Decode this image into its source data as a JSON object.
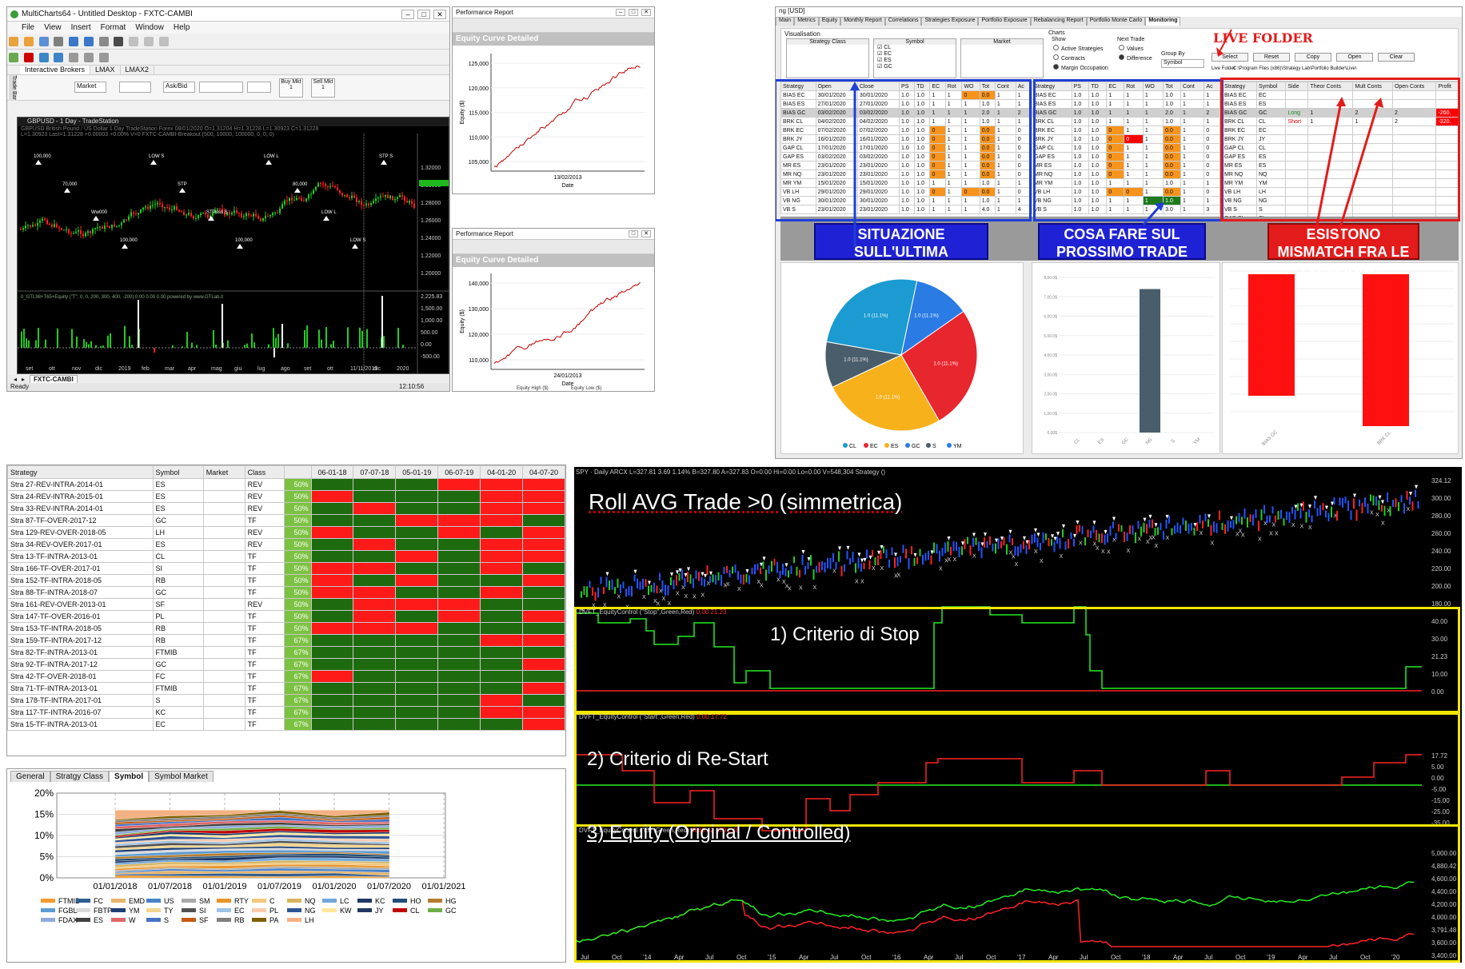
{
  "multicharts": {
    "title": "MultiCharts64 - Untitled Desktop - FXTC-CAMBI",
    "menu": [
      "File",
      "View",
      "Insert",
      "Format",
      "Window",
      "Help"
    ],
    "side_label": "Trade Bar",
    "broker_tabs": [
      "Interactive Brokers",
      "LMAX",
      "LMAX2"
    ],
    "order_fields": {
      "order_type": "Market",
      "ask_bid": "Ask/Bid",
      "buy_mkt": "Buy Mkt",
      "buy_qty": "1",
      "sell_mkt": "Sell Mkt",
      "sell_qty": "1"
    },
    "chart_title": "GBPUSD - 1 Day - TradeStation",
    "chart_info": "GBPUSD  British Pound / US Dollar  1 Day  TradeStation  Forex  08/01/2020  O=1.31204  H=1.31228  L=1.30923  C=1.31228",
    "chart_info2": "L=1.30923  Last=1.31228  +0.00003  +0.00%  V=0  FXTC-CAMBI-Breakout (500, 10000, 100000, 0, 0, 0)",
    "indicator_label": "0_GTL98+T65+Equity  (\"T\", 0, 0, 200, 300, 400, -200)  0.00  0.00  0.00  powered by www.GTLab.it",
    "price_ticks": [
      "1.32000",
      "1.30000",
      "1.28000",
      "1.26000",
      "1.24000",
      "1.22000",
      "1.20000"
    ],
    "ind_ticks": [
      "2,225.83",
      "1,500.00",
      "1,000.00",
      "500.00",
      "0.00",
      "-500.00"
    ],
    "time_ticks": [
      "set",
      "ott",
      "nov",
      "dic",
      "2019",
      "feb",
      "mar",
      "apr",
      "mag",
      "giu",
      "lug",
      "ago",
      "set",
      "ott",
      "11/11/2019",
      "dic",
      "2020"
    ],
    "sheet_tab": "FXTC-CAMBI",
    "status": "Ready",
    "clock": "12:10:56",
    "signals": [
      "100,000",
      "70,000",
      "Ww000",
      "100,000",
      "LOW S",
      "STP",
      "STPoss S",
      "100,000",
      "LOW L",
      "80,000",
      "LOW L",
      "LOW S",
      "STP S"
    ]
  },
  "perf1": {
    "title": "Performance Report",
    "header": "Equity Curve Detailed",
    "ylabel": "Equity ($)",
    "yticks": [
      "125,000",
      "120,000",
      "115,000",
      "110,000",
      "105,000"
    ],
    "date_tick": "13/02/2013",
    "xlabel": "Date"
  },
  "perf2": {
    "title": "Performance Report",
    "header": "Equity Curve Detailed",
    "ylabel": "Equity ($)",
    "yticks": [
      "140,000",
      "130,000",
      "120,000",
      "110,000"
    ],
    "date_tick": "24/01/2013",
    "xlabel": "Date",
    "legend": [
      "Equity High ($)",
      "Equity Low ($)"
    ]
  },
  "portfolio": {
    "title": "ng [USD]",
    "tabs": [
      "Main",
      "Metrics",
      "Equity",
      "Monthly Report",
      "Correlations",
      "Strategies Exposure",
      "Portfolio Exposure",
      "Rebalancing Report",
      "Portfolio Monte Carlo",
      "Monitoring"
    ],
    "visualisation": "Visualisation",
    "col_heads": [
      "Strategy Class",
      "Symbol",
      "Market"
    ],
    "symbols": [
      "CL",
      "EC",
      "ES",
      "GC"
    ],
    "charts_label": "Charts",
    "show_label": "Show",
    "show_opts": [
      "Active Strategies",
      "Contracts",
      "Margin Occupation"
    ],
    "next_trade": "Next Trade",
    "next_opts": [
      "Values",
      "Difference"
    ],
    "group_by": "Group By",
    "group_val": "Symbol",
    "buttons": [
      "Select",
      "Reset",
      "Copy",
      "Open",
      "Clear"
    ],
    "live_folder_label": "Live Folder",
    "live_folder_path": "C:\\Program Files (x86)\\Strategy Lab\\Portfolio Builder\\Live\\",
    "t1_head": [
      "Strategy",
      "Open",
      "Close",
      "PS",
      "TD",
      "EC",
      "Rot",
      "WO",
      "Tot",
      "Cont",
      "Ac"
    ],
    "t1_rows": [
      [
        "BIAS EC",
        "30/01/2020",
        "30/01/2020",
        "1.0",
        "1.0",
        "1",
        "1",
        "0",
        "0.0",
        "1",
        "1"
      ],
      [
        "BIAS ES",
        "27/01/2020",
        "27/01/2020",
        "1.0",
        "1.0",
        "1",
        "1",
        "1",
        "1.0",
        "1",
        "1"
      ],
      [
        "BIAS GC",
        "03/02/2020",
        "03/02/2020",
        "1.0",
        "1.0",
        "1",
        "1",
        "1",
        "2.0",
        "1",
        "2"
      ],
      [
        "BRK CL",
        "04/02/2020",
        "04/02/2020",
        "1.0",
        "1.0",
        "1",
        "1",
        "1",
        "1.0",
        "1",
        "1"
      ],
      [
        "BRK EC",
        "07/02/2020",
        "07/02/2020",
        "1.0",
        "1.0",
        "0",
        "1",
        "1",
        "0.0",
        "1",
        "0"
      ],
      [
        "BRK JY",
        "16/01/2020",
        "16/01/2020",
        "1.0",
        "1.0",
        "0",
        "1",
        "1",
        "0.0",
        "1",
        "0"
      ],
      [
        "GAP CL",
        "17/01/2020",
        "17/01/2020",
        "1.0",
        "1.0",
        "0",
        "1",
        "1",
        "0.0",
        "1",
        "0"
      ],
      [
        "GAP ES",
        "03/02/2020",
        "03/02/2020",
        "1.0",
        "1.0",
        "0",
        "1",
        "1",
        "0.0",
        "1",
        "0"
      ],
      [
        "MR ES",
        "23/01/2020",
        "23/01/2020",
        "1.0",
        "1.0",
        "0",
        "1",
        "1",
        "0.0",
        "1",
        "0"
      ],
      [
        "MR NQ",
        "23/01/2020",
        "23/01/2020",
        "1.0",
        "1.0",
        "0",
        "1",
        "1",
        "0.0",
        "1",
        "0"
      ],
      [
        "MR YM",
        "15/01/2020",
        "15/01/2020",
        "1.0",
        "1.0",
        "1",
        "1",
        "1",
        "1.0",
        "1",
        "1"
      ],
      [
        "VB LH",
        "29/01/2020",
        "29/01/2020",
        "1.0",
        "1.0",
        "0",
        "1",
        "0",
        "0.0",
        "1",
        "0"
      ],
      [
        "VB NG",
        "30/01/2020",
        "30/01/2020",
        "1.0",
        "1.0",
        "1",
        "1",
        "1",
        "1.0",
        "1",
        "1"
      ],
      [
        "VB S",
        "23/01/2020",
        "23/01/2020",
        "1.0",
        "1.0",
        "1",
        "1",
        "1",
        "4.0",
        "1",
        "4"
      ]
    ],
    "t2_head": [
      "Strategy",
      "PS",
      "TD",
      "EC",
      "Rot",
      "WO",
      "Tot",
      "Cont",
      "Ac"
    ],
    "t2_rows": [
      [
        "BIAS EC",
        "1.0",
        "1.0",
        "1",
        "1",
        "1",
        "1.0",
        "1",
        "1"
      ],
      [
        "BIAS ES",
        "1.0",
        "1.0",
        "1",
        "1",
        "1",
        "1.0",
        "1",
        "1"
      ],
      [
        "BIAS GC",
        "1.0",
        "1.0",
        "1",
        "1",
        "1",
        "2.0",
        "1",
        "2"
      ],
      [
        "BRK CL",
        "1.0",
        "1.0",
        "1",
        "1",
        "1",
        "1.0",
        "1",
        "1"
      ],
      [
        "BRK EC",
        "1.0",
        "1.0",
        "0",
        "1",
        "1",
        "0.0",
        "1",
        "0"
      ],
      [
        "BRK JY",
        "1.0",
        "1.0",
        "0",
        "0",
        "1",
        "0.0",
        "1",
        "0"
      ],
      [
        "GAP CL",
        "1.0",
        "1.0",
        "0",
        "1",
        "1",
        "0.0",
        "1",
        "0"
      ],
      [
        "GAP ES",
        "1.0",
        "1.0",
        "0",
        "1",
        "1",
        "0.0",
        "1",
        "0"
      ],
      [
        "MR ES",
        "1.0",
        "1.0",
        "0",
        "1",
        "1",
        "0.0",
        "1",
        "0"
      ],
      [
        "MR NQ",
        "1.0",
        "1.0",
        "0",
        "1",
        "1",
        "0.0",
        "1",
        "0"
      ],
      [
        "MR YM",
        "1.0",
        "1.0",
        "1",
        "1",
        "1",
        "1.0",
        "1",
        "1"
      ],
      [
        "VB LH",
        "1.0",
        "1.0",
        "0",
        "0",
        "1",
        "0.0",
        "1",
        "0"
      ],
      [
        "VB NG",
        "1.0",
        "1.0",
        "1",
        "1",
        "1",
        "1.0",
        "1",
        "1"
      ],
      [
        "VB S",
        "1.0",
        "1.0",
        "1",
        "1",
        "1",
        "3.0",
        "1",
        "3"
      ]
    ],
    "t3_head": [
      "Strategy",
      "Symbol",
      "Side",
      "Theor Conts",
      "Mult Conts",
      "Open Conts",
      "Profit"
    ],
    "t3_rows": [
      [
        "BIAS EC",
        "EC",
        "",
        "",
        "",
        "",
        ""
      ],
      [
        "BIAS ES",
        "ES",
        "",
        "",
        "",
        "",
        ""
      ],
      [
        "BIAS GC",
        "GC",
        "Long",
        "1",
        "2",
        "2",
        "-260."
      ],
      [
        "BRK CL",
        "CL",
        "Short",
        "1",
        "1",
        "2",
        "-320."
      ],
      [
        "BRK EC",
        "EC",
        "",
        "",
        "",
        "",
        ""
      ],
      [
        "BRK JY",
        "JY",
        "",
        "",
        "",
        "",
        ""
      ],
      [
        "GAP CL",
        "CL",
        "",
        "",
        "",
        "",
        ""
      ],
      [
        "GAP ES",
        "ES",
        "",
        "",
        "",
        "",
        ""
      ],
      [
        "MR ES",
        "ES",
        "",
        "",
        "",
        "",
        ""
      ],
      [
        "MR NQ",
        "NQ",
        "",
        "",
        "",
        "",
        ""
      ],
      [
        "MR YM",
        "YM",
        "",
        "",
        "",
        "",
        ""
      ],
      [
        "VB LH",
        "LH",
        "",
        "",
        "",
        "",
        ""
      ],
      [
        "VB NG",
        "NG",
        "",
        "",
        "",
        "",
        ""
      ],
      [
        "VB S",
        "S",
        "",
        "",
        "",
        "",
        ""
      ],
      [
        "GAP CL",
        "CL",
        "",
        "",
        "",
        "",
        ""
      ]
    ],
    "callout1": "SITUAZIONE SULL'ULTIMA OPERAZIONE CHIUSA",
    "callout2": "COSA FARE SUL PROSSIMO TRADE",
    "callout3": "ESISTONO MISMATCH FRA LE POSIZIONI ?",
    "live_folder_annot": "LIVE FOLDER",
    "pie_labels": [
      "1.0 (11.1%)",
      "1.0 (11.1%)",
      "1.0 (11.1%)",
      "1.0 (11.1%)",
      "1.0 (11.1%)"
    ],
    "pie_legend": [
      "CL",
      "EC",
      "ES",
      "GC",
      "S",
      "YM"
    ],
    "bar_ticks": [
      "8,00.0$",
      "7,00.0$",
      "6,00.0$",
      "5,00.0$",
      "4,00.0$",
      "3,00.0$",
      "2,00.0$",
      "1,00.0$",
      "0.00$"
    ],
    "bar_cats": [
      "CL",
      "ES",
      "GC",
      "NG",
      "S",
      "YM"
    ],
    "bar3_cats": [
      "BIAS GC",
      "BRK CL"
    ]
  },
  "heatmap": {
    "headers": [
      "Strategy",
      "Symbol",
      "Market",
      "Class",
      "",
      "06-01-18",
      "07-07-18",
      "05-01-19",
      "06-07-19",
      "04-01-20",
      "04-07-20"
    ],
    "rows": [
      [
        "Stra 27-REV-INTRA-2014-01",
        "ES",
        "",
        "REV",
        "50%",
        "g",
        "g",
        "g",
        "r",
        "r",
        "r"
      ],
      [
        "Stra 24-REV-INTRA-2015-01",
        "ES",
        "",
        "REV",
        "50%",
        "r",
        "g",
        "g",
        "g",
        "r",
        "r"
      ],
      [
        "Stra 33-REV-INTRA-2014-01",
        "ES",
        "",
        "REV",
        "50%",
        "g",
        "r",
        "g",
        "g",
        "r",
        "r"
      ],
      [
        "Stra 87-TF-OVER-2017-12",
        "GC",
        "",
        "TF",
        "50%",
        "g",
        "g",
        "r",
        "r",
        "r",
        "g"
      ],
      [
        "Stra 129-REV-OVER-2018-05",
        "LH",
        "",
        "REV",
        "50%",
        "r",
        "g",
        "g",
        "r",
        "g",
        "r"
      ],
      [
        "Stra 34-REV-OVER-2017-01",
        "ES",
        "",
        "REV",
        "50%",
        "g",
        "r",
        "g",
        "g",
        "r",
        "r"
      ],
      [
        "Stra 13-TF-INTRA-2013-01",
        "CL",
        "",
        "TF",
        "50%",
        "g",
        "g",
        "r",
        "g",
        "r",
        "r"
      ],
      [
        "Stra 166-TF-OVER-2017-01",
        "SI",
        "",
        "TF",
        "50%",
        "r",
        "r",
        "g",
        "g",
        "r",
        "g"
      ],
      [
        "Stra 152-TF-INTRA-2018-05",
        "RB",
        "",
        "TF",
        "50%",
        "r",
        "g",
        "r",
        "g",
        "g",
        "r"
      ],
      [
        "Stra 88-TF-INTRA-2018-07",
        "GC",
        "",
        "TF",
        "50%",
        "r",
        "r",
        "g",
        "g",
        "r",
        "g"
      ],
      [
        "Stra 161-REV-OVER-2013-01",
        "SF",
        "",
        "REV",
        "50%",
        "g",
        "r",
        "r",
        "r",
        "g",
        "g"
      ],
      [
        "Stra 147-TF-OVER-2016-01",
        "PL",
        "",
        "TF",
        "50%",
        "g",
        "r",
        "g",
        "r",
        "g",
        "r"
      ],
      [
        "Stra 153-TF-INTRA-2018-05",
        "RB",
        "",
        "TF",
        "50%",
        "r",
        "r",
        "r",
        "g",
        "g",
        "g"
      ],
      [
        "Stra 159-TF-INTRA-2017-12",
        "RB",
        "",
        "TF",
        "67%",
        "g",
        "g",
        "g",
        "g",
        "r",
        "r"
      ],
      [
        "Stra 82-TF-INTRA-2013-01",
        "FTMIB",
        "",
        "TF",
        "67%",
        "g",
        "g",
        "g",
        "g",
        "g",
        "g"
      ],
      [
        "Stra 92-TF-INTRA-2017-12",
        "GC",
        "",
        "TF",
        "67%",
        "g",
        "g",
        "g",
        "g",
        "g",
        "r"
      ],
      [
        "Stra 42-TF-OVER-2018-01",
        "FC",
        "",
        "TF",
        "67%",
        "r",
        "g",
        "g",
        "g",
        "g",
        "g"
      ],
      [
        "Stra 71-TF-INTRA-2013-01",
        "FTMIB",
        "",
        "TF",
        "67%",
        "g",
        "g",
        "g",
        "g",
        "g",
        "r"
      ],
      [
        "Stra 178-TF-INTRA-2017-01",
        "S",
        "",
        "TF",
        "67%",
        "g",
        "g",
        "g",
        "g",
        "r",
        "g"
      ],
      [
        "Stra 117-TF-INTRA-2016-07",
        "KC",
        "",
        "TF",
        "67%",
        "g",
        "g",
        "g",
        "g",
        "r",
        "r"
      ],
      [
        "Stra 15-TF-INTRA-2013-01",
        "EC",
        "",
        "TF",
        "67%",
        "g",
        "g",
        "g",
        "g",
        "g",
        "r"
      ]
    ],
    "tabs": [
      "General",
      "Stratgy Class",
      "Symbol",
      "Symbol Market"
    ],
    "active_tab": "Symbol"
  },
  "chart_data": {
    "type": "area",
    "title": "",
    "yticks": [
      "20%",
      "15%",
      "10%",
      "5%",
      "0%"
    ],
    "xticks": [
      "01/01/2018",
      "01/07/2018",
      "01/01/2019",
      "01/07/2019",
      "01/01/2020",
      "01/07/2020",
      "01/01/2021"
    ],
    "ylim": [
      0,
      20
    ],
    "x": [
      "01/01/2018",
      "01/07/2018",
      "01/01/2019",
      "01/07/2019",
      "01/01/2020",
      "01/07/2020"
    ],
    "stack_total": [
      16.0,
      16.0,
      16.0,
      16.0,
      16.0,
      16.0
    ],
    "legend": [
      {
        "name": "FTMIB",
        "color": "#f29b2d"
      },
      {
        "name": "FC",
        "color": "#2e5e8f"
      },
      {
        "name": "EMD",
        "color": "#e8b36b"
      },
      {
        "name": "US",
        "color": "#4a82c9"
      },
      {
        "name": "SM",
        "color": "#a9a9a9"
      },
      {
        "name": "RTY",
        "color": "#e8952a"
      },
      {
        "name": "C",
        "color": "#f3c77c"
      },
      {
        "name": "NQ",
        "color": "#d7b45e"
      },
      {
        "name": "LC",
        "color": "#6fa8dc"
      },
      {
        "name": "KC",
        "color": "#1f3864"
      },
      {
        "name": "HO",
        "color": "#1f4e79"
      },
      {
        "name": "HG",
        "color": "#b47c2e"
      },
      {
        "name": "FGBL",
        "color": "#5b9bd5"
      },
      {
        "name": "FBTP",
        "color": "#d9d9d9"
      },
      {
        "name": "YM",
        "color": "#1c3f75"
      },
      {
        "name": "TY",
        "color": "#f4d58d"
      },
      {
        "name": "SI",
        "color": "#525252"
      },
      {
        "name": "EC",
        "color": "#9dc3e6"
      },
      {
        "name": "PL",
        "color": "#f8cbad"
      },
      {
        "name": "NG",
        "color": "#2f5597"
      },
      {
        "name": "KW",
        "color": "#ffe699"
      },
      {
        "name": "JY",
        "color": "#203864"
      },
      {
        "name": "CL",
        "color": "#c00000"
      },
      {
        "name": "GC",
        "color": "#70ad47"
      },
      {
        "name": "FDAX",
        "color": "#8faadc"
      },
      {
        "name": "ES",
        "color": "#404040"
      },
      {
        "name": "W",
        "color": "#e06666"
      },
      {
        "name": "S",
        "color": "#4472c4"
      },
      {
        "name": "SF",
        "color": "#c55a11"
      },
      {
        "name": "RB",
        "color": "#808080"
      },
      {
        "name": "PA",
        "color": "#7f6000"
      },
      {
        "name": "LH",
        "color": "#f4b183"
      }
    ]
  },
  "spy": {
    "header": "SPY · Daily  ARCX  L=327.81  3.69  1.14%  B=327.80  A=327.83  O=0.00  Hi=0.00  Lo=0.00  V=548,304  Strategy ()",
    "title_annot": "Roll AVG Trade >0 (simmetrica)",
    "yticks": [
      "324.12",
      "300.00",
      "280.00",
      "260.00",
      "240.00",
      "220.00",
      "200.00",
      "180.00"
    ],
    "panel1_header": "DVFT_EquityControl (\"Stop\",Green,Red)",
    "panel1_vals": "0.00  21.23",
    "panel1_title": "1) Criterio di Stop",
    "panel1_ticks": [
      "40.00",
      "30.00",
      "21.23",
      "10.00",
      "0.00"
    ],
    "panel2_header": "DVFT_EquityControl (\"Start\",Green,Red)",
    "panel2_vals": "0.00  17.72",
    "panel2_title": "2) Criterio di Re-Start",
    "panel2_ticks": [
      "17.72",
      "5.00",
      "0.00",
      "-5.00",
      "-15.00",
      "-25.00",
      "-35.00"
    ],
    "panel3_header": "DVFT_EquityControl (\"Eq\",Green,Red)",
    "panel3_vals": "4880.42  3791.48",
    "panel3_title": "3) Equity (Original / Controlled)",
    "panel3_ticks": [
      "5,000.00",
      "4,880.42",
      "4,600.00",
      "4,400.00",
      "4,200.00",
      "4,000.00",
      "3,791.48",
      "3,600.00",
      "3,400.00"
    ],
    "xticks": [
      "Jul",
      "Oct",
      "'14",
      "Apr",
      "Jul",
      "Oct",
      "'15",
      "Apr",
      "Jul",
      "Oct",
      "'16",
      "Apr",
      "Jul",
      "Oct",
      "'17",
      "Apr",
      "Jul",
      "Oct",
      "'18",
      "Apr",
      "Jul",
      "Oct",
      "'19",
      "Apr",
      "Jul",
      "Oct",
      "'20"
    ]
  }
}
